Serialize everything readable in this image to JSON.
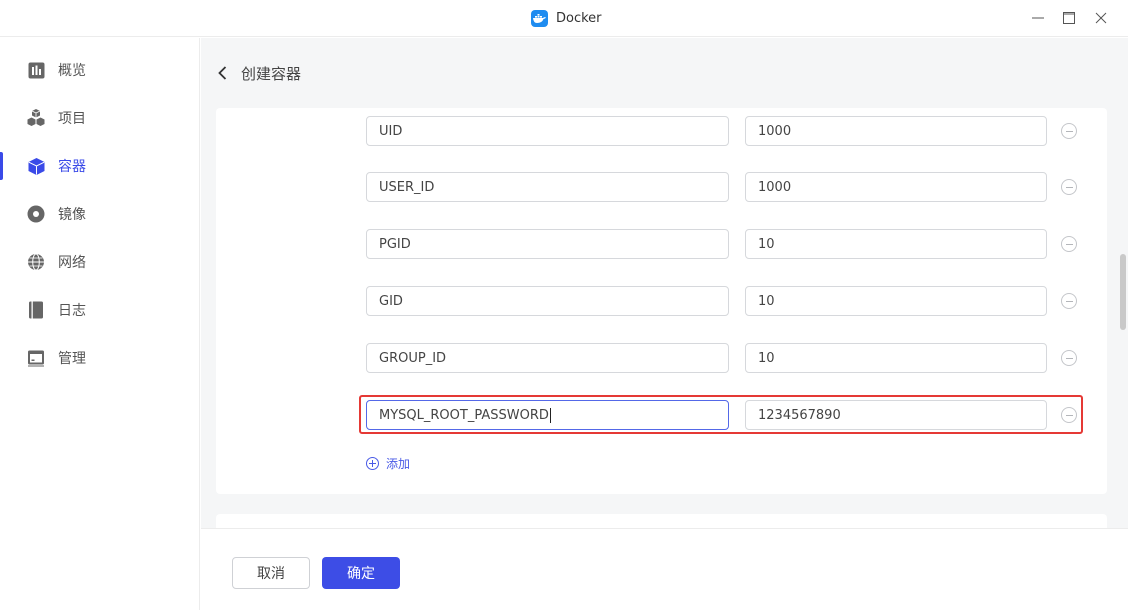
{
  "window": {
    "title": "Docker"
  },
  "sidebar": {
    "items": [
      {
        "label": "概览",
        "icon": "chart-icon"
      },
      {
        "label": "项目",
        "icon": "cubes-icon"
      },
      {
        "label": "容器",
        "icon": "cube-icon",
        "active": true
      },
      {
        "label": "镜像",
        "icon": "disc-icon"
      },
      {
        "label": "网络",
        "icon": "globe-icon"
      },
      {
        "label": "日志",
        "icon": "book-icon"
      },
      {
        "label": "管理",
        "icon": "monitor-icon"
      }
    ]
  },
  "page": {
    "title": "创建容器"
  },
  "env": {
    "rows": [
      {
        "key": "UID",
        "value": "1000"
      },
      {
        "key": "USER_ID",
        "value": "1000"
      },
      {
        "key": "PGID",
        "value": "10"
      },
      {
        "key": "GID",
        "value": "10"
      },
      {
        "key": "GROUP_ID",
        "value": "10"
      },
      {
        "key": "MYSQL_ROOT_PASSWORD",
        "value": "1234567890"
      }
    ],
    "add_label": "添加"
  },
  "footer": {
    "cancel_label": "取消",
    "confirm_label": "确定"
  },
  "colors": {
    "accent": "#3d4de6",
    "highlight": "#e53935",
    "docker": "#1f8cf0"
  }
}
